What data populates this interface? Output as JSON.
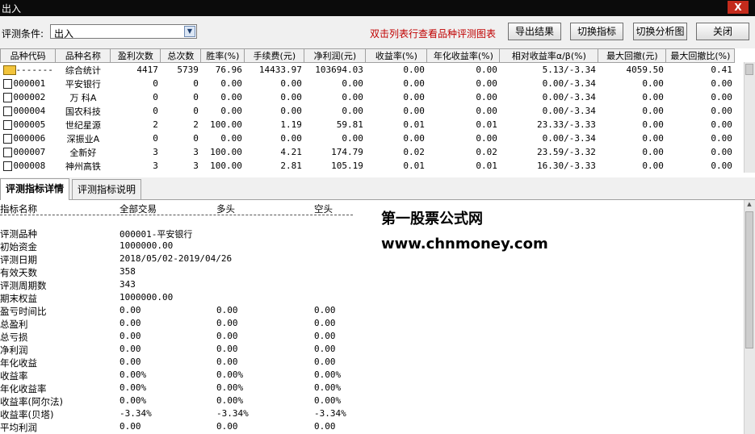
{
  "window": {
    "title": "出入",
    "close_glyph": "X"
  },
  "toolbar": {
    "condition_label": "评测条件:",
    "condition_value": "出入",
    "hint": "双击列表行查看品种评测图表",
    "buttons": {
      "export": "导出结果",
      "switch_indicator": "切换指标",
      "switch_chart": "切换分析图",
      "close": "关闭"
    }
  },
  "grid": {
    "columns": [
      "品种代码",
      "品种名称",
      "盈利次数",
      "总次数",
      "胜率(%)",
      "手续费(元)",
      "净利润(元)",
      "收益率(%)",
      "年化收益率(%)",
      "相对收益率α/β(%)",
      "最大回撤(元)",
      "最大回撤比(%)"
    ],
    "rows": [
      {
        "code": "-------",
        "name": "综合统计",
        "wins": "4417",
        "total": "5739",
        "rate": "76.96",
        "fee": "14433.97",
        "net": "103694.03",
        "ret": "0.00",
        "annual": "0.00",
        "rel": "5.13/-3.34",
        "dd": "4059.50",
        "ddr": "0.41",
        "icon": "folder-icon"
      },
      {
        "code": "000001",
        "name": "平安银行",
        "wins": "0",
        "total": "0",
        "rate": "0.00",
        "fee": "0.00",
        "net": "0.00",
        "ret": "0.00",
        "annual": "0.00",
        "rel": "0.00/-3.34",
        "dd": "0.00",
        "ddr": "0.00",
        "icon": "document-icon"
      },
      {
        "code": "000002",
        "name": "万 科A",
        "wins": "0",
        "total": "0",
        "rate": "0.00",
        "fee": "0.00",
        "net": "0.00",
        "ret": "0.00",
        "annual": "0.00",
        "rel": "0.00/-3.34",
        "dd": "0.00",
        "ddr": "0.00",
        "icon": "document-icon"
      },
      {
        "code": "000004",
        "name": "国农科技",
        "wins": "0",
        "total": "0",
        "rate": "0.00",
        "fee": "0.00",
        "net": "0.00",
        "ret": "0.00",
        "annual": "0.00",
        "rel": "0.00/-3.34",
        "dd": "0.00",
        "ddr": "0.00",
        "icon": "document-icon"
      },
      {
        "code": "000005",
        "name": "世纪星源",
        "wins": "2",
        "total": "2",
        "rate": "100.00",
        "fee": "1.19",
        "net": "59.81",
        "ret": "0.01",
        "annual": "0.01",
        "rel": "23.33/-3.33",
        "dd": "0.00",
        "ddr": "0.00",
        "icon": "document-icon"
      },
      {
        "code": "000006",
        "name": "深振业A",
        "wins": "0",
        "total": "0",
        "rate": "0.00",
        "fee": "0.00",
        "net": "0.00",
        "ret": "0.00",
        "annual": "0.00",
        "rel": "0.00/-3.34",
        "dd": "0.00",
        "ddr": "0.00",
        "icon": "document-icon"
      },
      {
        "code": "000007",
        "name": "全新好",
        "wins": "3",
        "total": "3",
        "rate": "100.00",
        "fee": "4.21",
        "net": "174.79",
        "ret": "0.02",
        "annual": "0.02",
        "rel": "23.59/-3.32",
        "dd": "0.00",
        "ddr": "0.00",
        "icon": "document-icon"
      },
      {
        "code": "000008",
        "name": "神州高铁",
        "wins": "3",
        "total": "3",
        "rate": "100.00",
        "fee": "2.81",
        "net": "105.19",
        "ret": "0.01",
        "annual": "0.01",
        "rel": "16.30/-3.33",
        "dd": "0.00",
        "ddr": "0.00",
        "icon": "document-icon"
      }
    ]
  },
  "tabs": [
    "评测指标详情",
    "评测指标说明"
  ],
  "detail": {
    "headers": [
      "指标名称",
      "全部交易",
      "多头",
      "空头"
    ],
    "rows": [
      {
        "label": "评测品种",
        "all": "000001-平安银行",
        "long": "",
        "short": ""
      },
      {
        "label": "初始资金",
        "all": "1000000.00",
        "long": "",
        "short": ""
      },
      {
        "label": "评测日期",
        "all": "2018/05/02-2019/04/26",
        "long": "",
        "short": ""
      },
      {
        "label": "有效天数",
        "all": "358",
        "long": "",
        "short": ""
      },
      {
        "label": "评测周期数",
        "all": "343",
        "long": "",
        "short": ""
      },
      {
        "label": "期末权益",
        "all": "1000000.00",
        "long": "",
        "short": ""
      },
      {
        "label": "盈亏时间比",
        "all": "0.00",
        "long": "0.00",
        "short": "0.00"
      },
      {
        "label": "总盈利",
        "all": "0.00",
        "long": "0.00",
        "short": "0.00"
      },
      {
        "label": "总亏损",
        "all": "0.00",
        "long": "0.00",
        "short": "0.00"
      },
      {
        "label": "净利润",
        "all": "0.00",
        "long": "0.00",
        "short": "0.00"
      },
      {
        "label": "年化收益",
        "all": "0.00",
        "long": "0.00",
        "short": "0.00"
      },
      {
        "label": "收益率",
        "all": "0.00%",
        "long": "0.00%",
        "short": "0.00%"
      },
      {
        "label": "年化收益率",
        "all": "0.00%",
        "long": "0.00%",
        "short": "0.00%"
      },
      {
        "label": "收益率(阿尔法)",
        "all": "0.00%",
        "long": "0.00%",
        "short": "0.00%"
      },
      {
        "label": "收益率(贝塔)",
        "all": "-3.34%",
        "long": "-3.34%",
        "short": "-3.34%"
      },
      {
        "label": "平均利润",
        "all": "0.00",
        "long": "0.00",
        "short": "0.00"
      }
    ],
    "watermark_line1": "第一股票公式网",
    "watermark_line2": "www.chnmoney.com"
  }
}
